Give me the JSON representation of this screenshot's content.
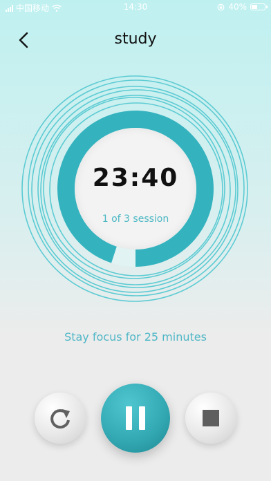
{
  "status_bar": {
    "carrier": "中国移动",
    "time": "14:30",
    "battery": "40%"
  },
  "nav": {
    "title": "study"
  },
  "timer": {
    "time": "23:40",
    "session": "1 of 3 session",
    "progress": 0.95
  },
  "message": "Stay focus for 25 minutes",
  "controls": {
    "restart_icon": "restart-icon",
    "pause_icon": "pause-icon",
    "stop_icon": "stop-icon"
  },
  "colors": {
    "accent": "#34b3bf",
    "ring": "#5ccbd3",
    "text_accent": "#4fb7c6"
  }
}
